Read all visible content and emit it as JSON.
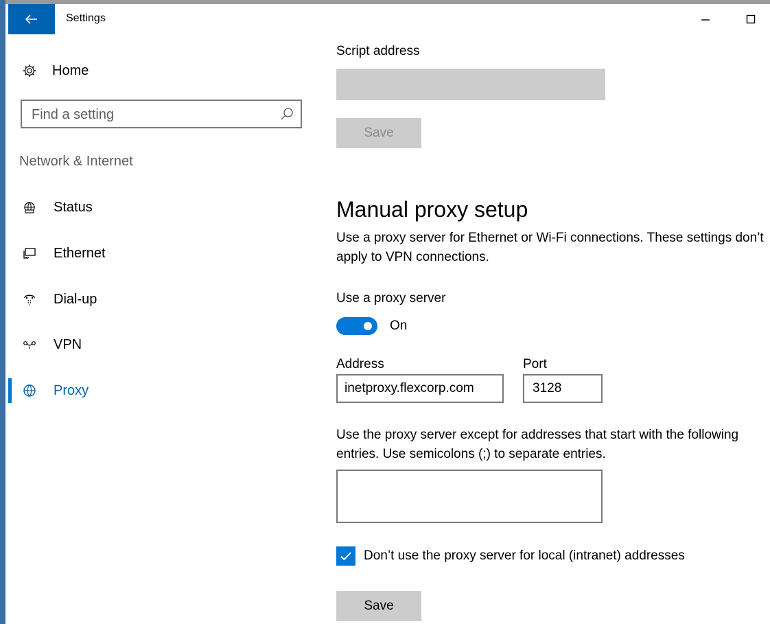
{
  "titlebar": {
    "title": "Settings",
    "back_icon": "back-arrow-icon",
    "min_glyph": "—",
    "max_glyph": "☐"
  },
  "sidebar": {
    "home": "Home",
    "search_placeholder": "Find a setting",
    "section": "Network & Internet",
    "items": [
      {
        "label": "Status",
        "icon": "globe-status-icon",
        "active": false
      },
      {
        "label": "Ethernet",
        "icon": "ethernet-icon",
        "active": false
      },
      {
        "label": "Dial-up",
        "icon": "dial-up-icon",
        "active": false
      },
      {
        "label": "VPN",
        "icon": "vpn-icon",
        "active": false
      },
      {
        "label": "Proxy",
        "icon": "globe-icon",
        "active": true
      }
    ]
  },
  "main": {
    "script_label": "Script address",
    "script_value": "",
    "script_save": "Save",
    "heading": "Manual proxy setup",
    "description": "Use a proxy server for Ethernet or Wi-Fi connections. These settings don’t apply to VPN connections.",
    "use_proxy_label": "Use a proxy server",
    "toggle_state": "On",
    "address_label": "Address",
    "address_value": "inetproxy.flexcorp.com",
    "port_label": "Port",
    "port_value": "3128",
    "exceptions_desc": "Use the proxy server except for addresses that start with the following entries. Use semicolons (;) to separate entries.",
    "exceptions_value": "",
    "local_checkbox_label": "Don’t use the proxy server for local (intranet) addresses",
    "local_checked": true,
    "save": "Save"
  },
  "colors": {
    "accent": "#0078d7",
    "titlebar_button": "#0063b1",
    "disabled_gray": "#cccccc"
  }
}
